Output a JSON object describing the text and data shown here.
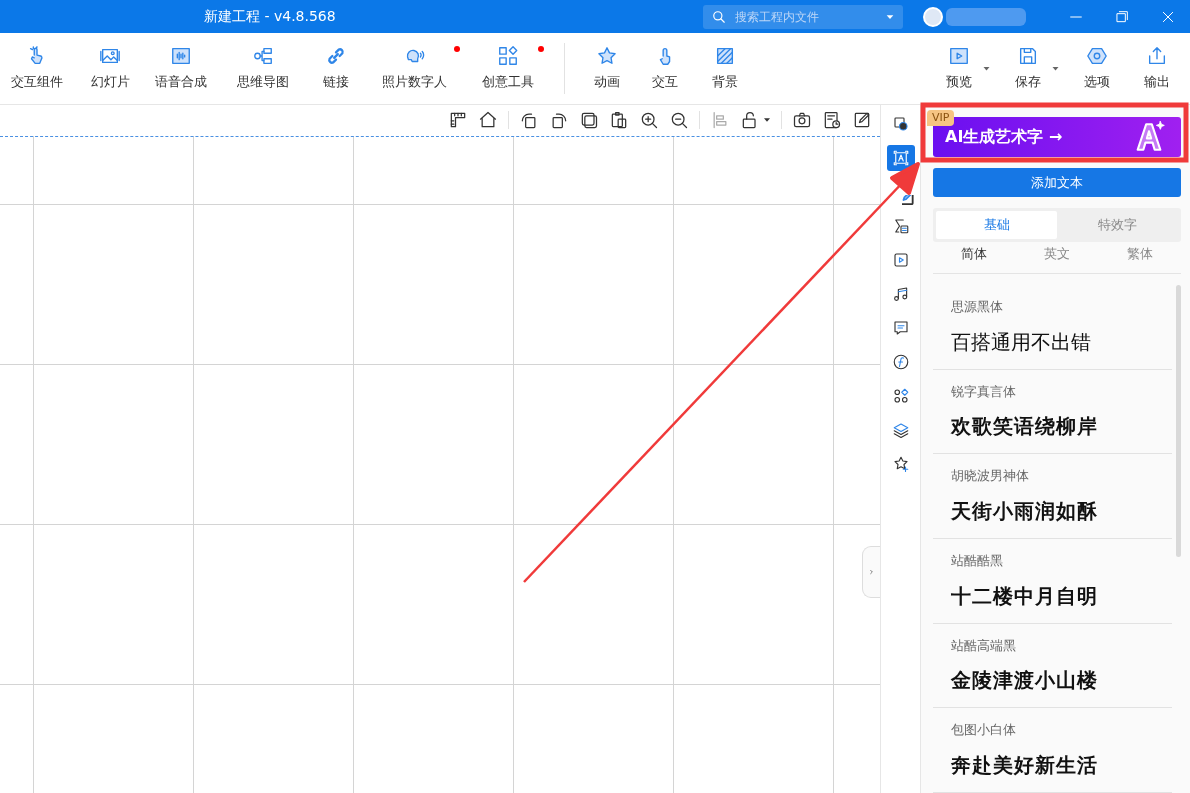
{
  "window": {
    "title": "新建工程 - v4.8.568"
  },
  "search": {
    "placeholder": "搜索工程内文件"
  },
  "toolbar_left": [
    {
      "label": "交互组件",
      "badge": false
    },
    {
      "label": "幻灯片",
      "badge": false
    },
    {
      "label": "语音合成",
      "badge": false
    },
    {
      "label": "思维导图",
      "badge": false
    },
    {
      "label": "链接",
      "badge": false
    },
    {
      "label": "照片数字人",
      "badge": true
    },
    {
      "label": "创意工具",
      "badge": true
    }
  ],
  "toolbar_mid": [
    {
      "label": "动画"
    },
    {
      "label": "交互"
    },
    {
      "label": "背景"
    }
  ],
  "toolbar_right": [
    {
      "label": "预览",
      "dropdown": true
    },
    {
      "label": "保存",
      "dropdown": true
    },
    {
      "label": "选项",
      "dropdown": false
    },
    {
      "label": "输出",
      "dropdown": false
    }
  ],
  "rail": [
    {
      "selected": false
    },
    {
      "selected": true
    },
    {
      "selected": false
    },
    {
      "selected": false
    },
    {
      "selected": false
    },
    {
      "selected": false
    },
    {
      "selected": false
    },
    {
      "selected": false
    },
    {
      "selected": false
    },
    {
      "selected": false
    },
    {
      "selected": false
    }
  ],
  "panel": {
    "vip_badge": "VIP",
    "banner": "AI生成艺术字 →",
    "add_button": "添加文本",
    "tabs": [
      {
        "label": "基础",
        "selected": true
      },
      {
        "label": "特效字",
        "selected": false
      }
    ],
    "subtabs": [
      {
        "label": "简体",
        "selected": true
      },
      {
        "label": "英文",
        "selected": false
      },
      {
        "label": "繁体",
        "selected": false
      }
    ],
    "fonts": [
      {
        "name": "思源黑体",
        "sample": "百搭通用不出错",
        "kind": "regular"
      },
      {
        "name": "锐字真言体",
        "sample": "欢歌笑语绕柳岸",
        "kind": "display"
      },
      {
        "name": "胡晓波男神体",
        "sample": "天街小雨润如酥",
        "kind": "display"
      },
      {
        "name": "站酷酷黑",
        "sample": "十二楼中月自明",
        "kind": "display"
      },
      {
        "name": "站酷高端黑",
        "sample": "金陵津渡小山楼",
        "kind": "display"
      },
      {
        "name": "包图小白体",
        "sample": "奔赴美好新生活",
        "kind": "display"
      }
    ]
  }
}
